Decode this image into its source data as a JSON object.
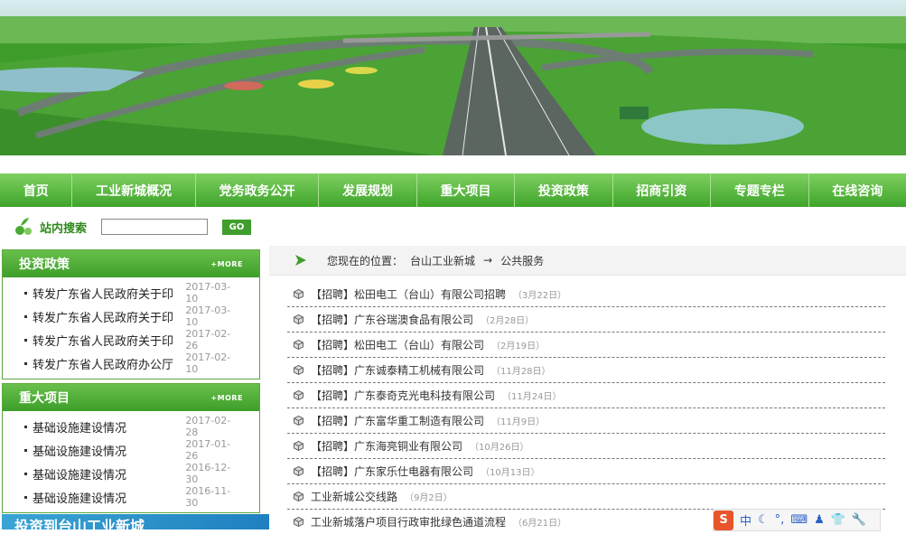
{
  "nav": {
    "items": [
      "首页",
      "工业新城概况",
      "党务政务公开",
      "发展规划",
      "重大项目",
      "投资政策",
      "招商引资",
      "专题专栏",
      "在线咨询"
    ]
  },
  "search": {
    "label": "站内搜索",
    "button": "GO",
    "value": ""
  },
  "panels": [
    {
      "title": "投资政策",
      "more": "+MORE",
      "items": [
        {
          "title": "转发广东省人民政府关于印",
          "date": "2017-03-10"
        },
        {
          "title": "转发广东省人民政府关于印",
          "date": "2017-03-10"
        },
        {
          "title": "转发广东省人民政府关于印",
          "date": "2017-02-26"
        },
        {
          "title": "转发广东省人民政府办公厅",
          "date": "2017-02-10"
        }
      ]
    },
    {
      "title": "重大项目",
      "more": "+MORE",
      "items": [
        {
          "title": "基础设施建设情况",
          "date": "2017-02-28"
        },
        {
          "title": "基础设施建设情况",
          "date": "2017-01-26"
        },
        {
          "title": "基础设施建设情况",
          "date": "2016-12-30"
        },
        {
          "title": "基础设施建设情况",
          "date": "2016-11-30"
        }
      ]
    }
  ],
  "bottom_banner": "投资到台山工业新城",
  "breadcrumb": {
    "prefix": "您现在的位置：",
    "home": "台山工业新城",
    "arrow": "→",
    "current": "公共服务"
  },
  "articles": [
    {
      "title": "【招聘】松田电工（台山）有限公司招聘",
      "date": "（3月22日）"
    },
    {
      "title": "【招聘】广东谷瑞澳食品有限公司",
      "date": "（2月28日）"
    },
    {
      "title": "【招聘】松田电工（台山）有限公司",
      "date": "（2月19日）"
    },
    {
      "title": "【招聘】广东诚泰精工机械有限公司",
      "date": "（11月28日）"
    },
    {
      "title": "【招聘】广东泰奇克光电科技有限公司",
      "date": "（11月24日）"
    },
    {
      "title": "【招聘】广东富华重工制造有限公司",
      "date": "（11月9日）"
    },
    {
      "title": "【招聘】广东海亮铜业有限公司",
      "date": "（10月26日）"
    },
    {
      "title": "【招聘】广东家乐仕电器有限公司",
      "date": "（10月13日）"
    },
    {
      "title": "工业新城公交线路",
      "date": "（9月2日）"
    },
    {
      "title": "工业新城落户项目行政审批绿色通道流程",
      "date": "（6月21日）"
    }
  ],
  "ime": {
    "logo": "S",
    "mode": "中"
  },
  "colors": {
    "nav_green": "#4cb236",
    "accent_blue": "#2a62c8"
  }
}
